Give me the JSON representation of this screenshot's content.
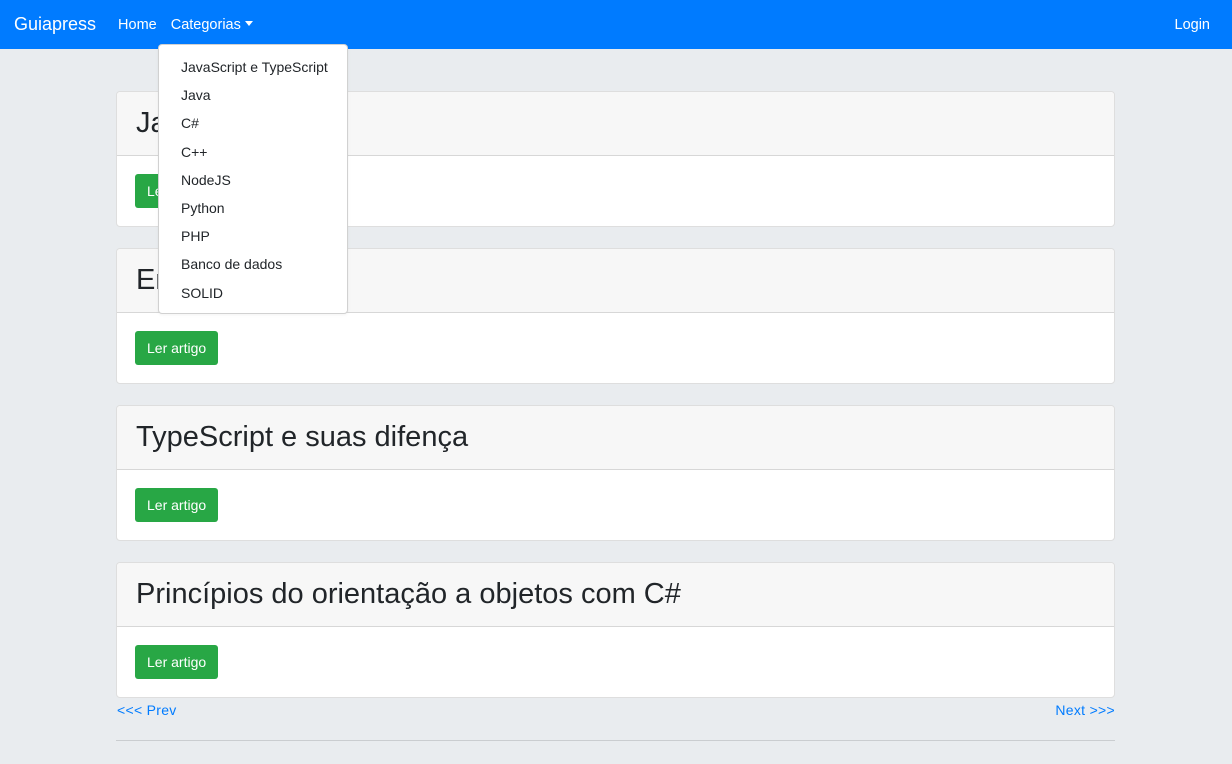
{
  "navbar": {
    "brand": "Guiapress",
    "home": "Home",
    "categories": "Categorias",
    "login": "Login",
    "accent_color": "#007bff"
  },
  "dropdown": {
    "items": [
      "JavaScript e TypeScript",
      "Java",
      "C#",
      "C++",
      "NodeJS",
      "Python",
      "PHP",
      "Banco de dados",
      "SOLID"
    ]
  },
  "articles": [
    {
      "title": "Ja… orto",
      "button": "Ler artigo"
    },
    {
      "title": "Em… O",
      "button": "Ler artigo"
    },
    {
      "title": "TypeScript e suas difença",
      "button": "Ler artigo"
    },
    {
      "title": "Princípios do orientação a objetos com C#",
      "button": "Ler artigo"
    }
  ],
  "pagination": {
    "prev": "<<< Prev",
    "next": "Next >>>"
  },
  "colors": {
    "button": "#28a745",
    "background": "#e9ecef"
  }
}
